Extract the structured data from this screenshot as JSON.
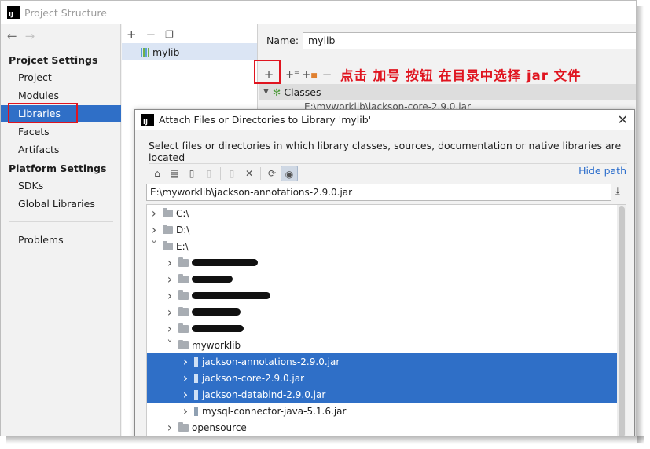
{
  "window": {
    "title": "Project Structure",
    "logo_text": "IJ"
  },
  "sidebar": {
    "back_icon": "arrow-left-icon",
    "forward_icon": "arrow-right-icon",
    "project_settings_heading": "Projcet Settings",
    "project_items": [
      "Project",
      "Modules",
      "Libraries",
      "Facets",
      "Artifacts"
    ],
    "selected_item": "Libraries",
    "platform_settings_heading": "Platform Settings",
    "platform_items": [
      "SDKs",
      "Global Libraries"
    ],
    "problems_label": "Problems"
  },
  "library_list": {
    "toolbar": [
      "plus-icon",
      "minus-icon",
      "copy-icon"
    ],
    "item": "mylib"
  },
  "library_detail": {
    "name_label": "Name:",
    "name_value": "mylib",
    "toolbar": [
      "plus-icon",
      "add-with-sources-icon",
      "add-classes-icon",
      "minus-icon"
    ],
    "annotation": "点击 加号 按钮 在目录中选择 jar 文件",
    "classes_label": "Classes",
    "hidden_row": "E:\\myworklib\\jackson-core-2.9.0.jar"
  },
  "dialog": {
    "title": "Attach Files or Directories to Library 'mylib'",
    "description": "Select files or directories in which library classes, sources, documentation or native libraries are located",
    "toolbar_icons": [
      "home-icon",
      "desktop-icon",
      "project-folder-icon",
      "module-folder-icon",
      "new-folder-icon",
      "delete-icon",
      "refresh-icon",
      "show-hidden-icon"
    ],
    "hide_path_label": "Hide path",
    "path_value": "E:\\myworklib\\jackson-annotations-2.9.0.jar",
    "tree": [
      {
        "label": "C:\\",
        "depth": 0,
        "expanded": false,
        "kind": "folder"
      },
      {
        "label": "D:\\",
        "depth": 0,
        "expanded": false,
        "kind": "folder"
      },
      {
        "label": "E:\\",
        "depth": 0,
        "expanded": true,
        "kind": "folder"
      },
      {
        "label": "",
        "depth": 1,
        "expanded": false,
        "kind": "folder",
        "redacted": true
      },
      {
        "label": "",
        "depth": 1,
        "expanded": false,
        "kind": "folder",
        "redacted": true
      },
      {
        "label": "",
        "depth": 1,
        "expanded": false,
        "kind": "folder",
        "redacted": true
      },
      {
        "label": "",
        "depth": 1,
        "expanded": false,
        "kind": "folder",
        "redacted": true
      },
      {
        "label": "",
        "depth": 1,
        "expanded": false,
        "kind": "folder",
        "redacted": true
      },
      {
        "label": "myworklib",
        "depth": 1,
        "expanded": true,
        "kind": "folder"
      },
      {
        "label": "jackson-annotations-2.9.0.jar",
        "depth": 2,
        "expanded": false,
        "kind": "jar",
        "selected": true
      },
      {
        "label": "jackson-core-2.9.0.jar",
        "depth": 2,
        "expanded": false,
        "kind": "jar",
        "selected": true
      },
      {
        "label": "jackson-databind-2.9.0.jar",
        "depth": 2,
        "expanded": false,
        "kind": "jar",
        "selected": true
      },
      {
        "label": "mysql-connector-java-5.1.6.jar",
        "depth": 2,
        "expanded": false,
        "kind": "jar"
      },
      {
        "label": "opensource",
        "depth": 1,
        "expanded": false,
        "kind": "folder"
      }
    ]
  },
  "colors": {
    "selection": "#2f6fc7",
    "annotation": "#e0141f",
    "link": "#2e6fcc"
  }
}
